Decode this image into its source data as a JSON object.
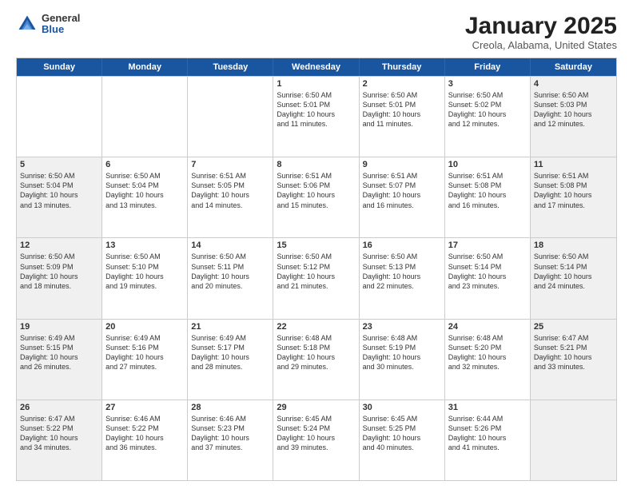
{
  "header": {
    "logo_general": "General",
    "logo_blue": "Blue",
    "title": "January 2025",
    "subtitle": "Creola, Alabama, United States"
  },
  "days_of_week": [
    "Sunday",
    "Monday",
    "Tuesday",
    "Wednesday",
    "Thursday",
    "Friday",
    "Saturday"
  ],
  "weeks": [
    [
      {
        "day": "",
        "info": "",
        "shaded": false
      },
      {
        "day": "",
        "info": "",
        "shaded": false
      },
      {
        "day": "",
        "info": "",
        "shaded": false
      },
      {
        "day": "1",
        "info": "Sunrise: 6:50 AM\nSunset: 5:01 PM\nDaylight: 10 hours\nand 11 minutes.",
        "shaded": false
      },
      {
        "day": "2",
        "info": "Sunrise: 6:50 AM\nSunset: 5:01 PM\nDaylight: 10 hours\nand 11 minutes.",
        "shaded": false
      },
      {
        "day": "3",
        "info": "Sunrise: 6:50 AM\nSunset: 5:02 PM\nDaylight: 10 hours\nand 12 minutes.",
        "shaded": false
      },
      {
        "day": "4",
        "info": "Sunrise: 6:50 AM\nSunset: 5:03 PM\nDaylight: 10 hours\nand 12 minutes.",
        "shaded": true
      }
    ],
    [
      {
        "day": "5",
        "info": "Sunrise: 6:50 AM\nSunset: 5:04 PM\nDaylight: 10 hours\nand 13 minutes.",
        "shaded": true
      },
      {
        "day": "6",
        "info": "Sunrise: 6:50 AM\nSunset: 5:04 PM\nDaylight: 10 hours\nand 13 minutes.",
        "shaded": false
      },
      {
        "day": "7",
        "info": "Sunrise: 6:51 AM\nSunset: 5:05 PM\nDaylight: 10 hours\nand 14 minutes.",
        "shaded": false
      },
      {
        "day": "8",
        "info": "Sunrise: 6:51 AM\nSunset: 5:06 PM\nDaylight: 10 hours\nand 15 minutes.",
        "shaded": false
      },
      {
        "day": "9",
        "info": "Sunrise: 6:51 AM\nSunset: 5:07 PM\nDaylight: 10 hours\nand 16 minutes.",
        "shaded": false
      },
      {
        "day": "10",
        "info": "Sunrise: 6:51 AM\nSunset: 5:08 PM\nDaylight: 10 hours\nand 16 minutes.",
        "shaded": false
      },
      {
        "day": "11",
        "info": "Sunrise: 6:51 AM\nSunset: 5:08 PM\nDaylight: 10 hours\nand 17 minutes.",
        "shaded": true
      }
    ],
    [
      {
        "day": "12",
        "info": "Sunrise: 6:50 AM\nSunset: 5:09 PM\nDaylight: 10 hours\nand 18 minutes.",
        "shaded": true
      },
      {
        "day": "13",
        "info": "Sunrise: 6:50 AM\nSunset: 5:10 PM\nDaylight: 10 hours\nand 19 minutes.",
        "shaded": false
      },
      {
        "day": "14",
        "info": "Sunrise: 6:50 AM\nSunset: 5:11 PM\nDaylight: 10 hours\nand 20 minutes.",
        "shaded": false
      },
      {
        "day": "15",
        "info": "Sunrise: 6:50 AM\nSunset: 5:12 PM\nDaylight: 10 hours\nand 21 minutes.",
        "shaded": false
      },
      {
        "day": "16",
        "info": "Sunrise: 6:50 AM\nSunset: 5:13 PM\nDaylight: 10 hours\nand 22 minutes.",
        "shaded": false
      },
      {
        "day": "17",
        "info": "Sunrise: 6:50 AM\nSunset: 5:14 PM\nDaylight: 10 hours\nand 23 minutes.",
        "shaded": false
      },
      {
        "day": "18",
        "info": "Sunrise: 6:50 AM\nSunset: 5:14 PM\nDaylight: 10 hours\nand 24 minutes.",
        "shaded": true
      }
    ],
    [
      {
        "day": "19",
        "info": "Sunrise: 6:49 AM\nSunset: 5:15 PM\nDaylight: 10 hours\nand 26 minutes.",
        "shaded": true
      },
      {
        "day": "20",
        "info": "Sunrise: 6:49 AM\nSunset: 5:16 PM\nDaylight: 10 hours\nand 27 minutes.",
        "shaded": false
      },
      {
        "day": "21",
        "info": "Sunrise: 6:49 AM\nSunset: 5:17 PM\nDaylight: 10 hours\nand 28 minutes.",
        "shaded": false
      },
      {
        "day": "22",
        "info": "Sunrise: 6:48 AM\nSunset: 5:18 PM\nDaylight: 10 hours\nand 29 minutes.",
        "shaded": false
      },
      {
        "day": "23",
        "info": "Sunrise: 6:48 AM\nSunset: 5:19 PM\nDaylight: 10 hours\nand 30 minutes.",
        "shaded": false
      },
      {
        "day": "24",
        "info": "Sunrise: 6:48 AM\nSunset: 5:20 PM\nDaylight: 10 hours\nand 32 minutes.",
        "shaded": false
      },
      {
        "day": "25",
        "info": "Sunrise: 6:47 AM\nSunset: 5:21 PM\nDaylight: 10 hours\nand 33 minutes.",
        "shaded": true
      }
    ],
    [
      {
        "day": "26",
        "info": "Sunrise: 6:47 AM\nSunset: 5:22 PM\nDaylight: 10 hours\nand 34 minutes.",
        "shaded": true
      },
      {
        "day": "27",
        "info": "Sunrise: 6:46 AM\nSunset: 5:22 PM\nDaylight: 10 hours\nand 36 minutes.",
        "shaded": false
      },
      {
        "day": "28",
        "info": "Sunrise: 6:46 AM\nSunset: 5:23 PM\nDaylight: 10 hours\nand 37 minutes.",
        "shaded": false
      },
      {
        "day": "29",
        "info": "Sunrise: 6:45 AM\nSunset: 5:24 PM\nDaylight: 10 hours\nand 39 minutes.",
        "shaded": false
      },
      {
        "day": "30",
        "info": "Sunrise: 6:45 AM\nSunset: 5:25 PM\nDaylight: 10 hours\nand 40 minutes.",
        "shaded": false
      },
      {
        "day": "31",
        "info": "Sunrise: 6:44 AM\nSunset: 5:26 PM\nDaylight: 10 hours\nand 41 minutes.",
        "shaded": false
      },
      {
        "day": "",
        "info": "",
        "shaded": true
      }
    ]
  ]
}
